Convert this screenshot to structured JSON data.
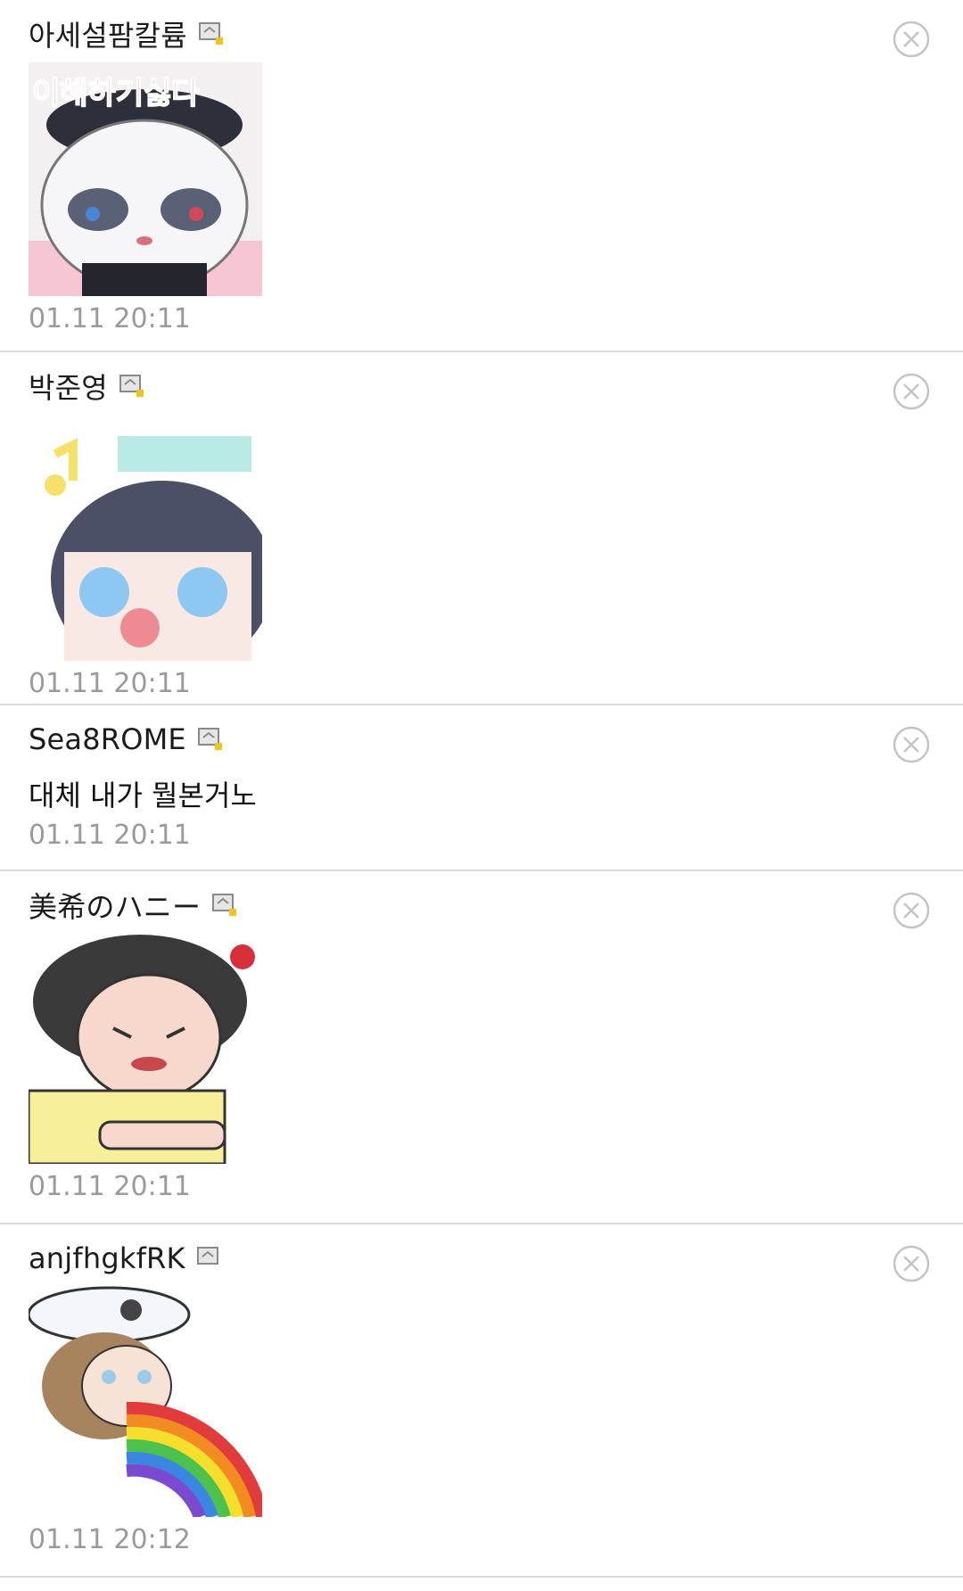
{
  "comments": [
    {
      "name": "아세설팜칼륨",
      "kind": "sticker",
      "sticker_caption": "이해하기싫다",
      "time": "01.11 20:11"
    },
    {
      "name": "박준영",
      "kind": "sticker",
      "time": "01.11 20:11"
    },
    {
      "name": "Sea8ROME",
      "kind": "text",
      "text": "대체 내가 뭘본거노",
      "time": "01.11 20:11"
    },
    {
      "name": "美希のハニー",
      "kind": "sticker",
      "time": "01.11 20:11"
    },
    {
      "name": "anjfhgkfRK",
      "kind": "sticker",
      "time": "01.11 20:12"
    }
  ],
  "icons": {
    "badge": "mobile-badge-icon",
    "close": "close-circle-icon"
  },
  "colors": {
    "divider": "#dcdcdc",
    "timestamp": "#9a9a9a",
    "close_icon": "#c4c4c4"
  }
}
